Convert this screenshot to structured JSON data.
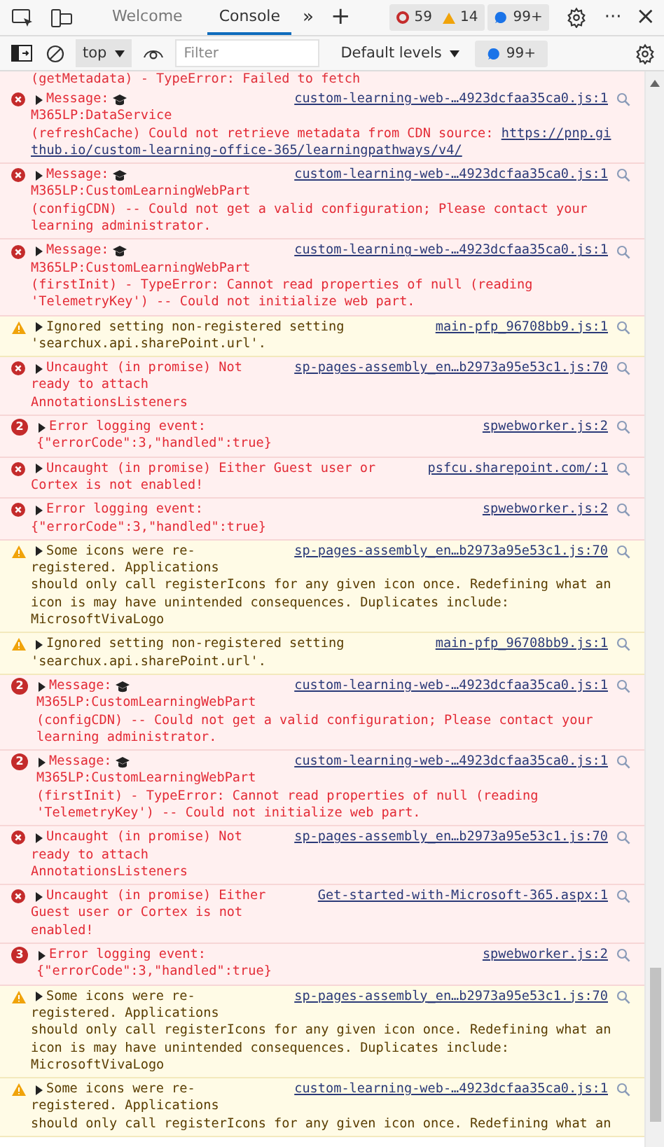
{
  "tabs": [
    {
      "label": "Welcome",
      "selected": false
    },
    {
      "label": "Console",
      "selected": true
    }
  ],
  "more_tabs": "»",
  "add_tab": "+",
  "issue_counts": {
    "errors": "59",
    "warnings": "14"
  },
  "info_count": "99+",
  "more_menu": "···",
  "close": "×",
  "context_select": {
    "value": "top"
  },
  "filter": {
    "placeholder": "Filter"
  },
  "levels_select": {
    "value": "Default levels"
  },
  "filter_info_count": "99+",
  "cut_line": "(getMetadata) - TypeError: Failed to fetch",
  "messages": [
    {
      "kind": "error",
      "expanded": false,
      "head": "Message:",
      "mortarboard": true,
      "source": "custom-learning-web-…4923dcfaa35ca0.js:1",
      "lines": [
        {
          "text": "M365LP:DataService"
        },
        {
          "text": "(refreshCache) Could not retrieve metadata from CDN source: ",
          "url": "https://pnp.gi"
        },
        {
          "url": "thub.io/custom-learning-office-365/learningpathways/v4/"
        }
      ]
    },
    {
      "kind": "error",
      "expanded": false,
      "head": "Message:",
      "mortarboard": true,
      "source": "custom-learning-web-…4923dcfaa35ca0.js:1",
      "lines": [
        {
          "text": "M365LP:CustomLearningWebPart"
        },
        {
          "text": "(configCDN) -- Could not get a valid configuration; Please contact your"
        },
        {
          "text": "learning administrator."
        }
      ]
    },
    {
      "kind": "error",
      "expanded": false,
      "head": "Message:",
      "mortarboard": true,
      "source": "custom-learning-web-…4923dcfaa35ca0.js:1",
      "lines": [
        {
          "text": "M365LP:CustomLearningWebPart"
        },
        {
          "text": "(firstInit) - TypeError: Cannot read properties of null (reading"
        },
        {
          "text": "'TelemetryKey') -- Could not initialize web part."
        }
      ]
    },
    {
      "kind": "warning",
      "expanded": false,
      "head": "Ignored setting non-registered setting",
      "source": "main-pfp_96708bb9.js:1",
      "lines": [
        {
          "text": "'searchux.api.sharePoint.url'."
        }
      ]
    },
    {
      "kind": "error",
      "expanded": false,
      "head": "Uncaught (in promise) Not",
      "source": "sp-pages-assembly_en…b2973a95e53c1.js:70",
      "lines": [
        {
          "text": "ready to attach"
        },
        {
          "text": "AnnotationsListeners"
        }
      ]
    },
    {
      "kind": "error",
      "count": "2",
      "expanded": false,
      "head": "Error logging event:",
      "source": "spwebworker.js:2",
      "lines": [
        {
          "text": "{\"errorCode\":3,\"handled\":true}"
        }
      ]
    },
    {
      "kind": "error",
      "expanded": false,
      "head": "Uncaught (in promise) Either Guest user or",
      "source": "psfcu.sharepoint.com/:1",
      "lines": [
        {
          "text": "Cortex is not enabled!"
        }
      ]
    },
    {
      "kind": "error",
      "expanded": false,
      "head": "Error logging event:",
      "source": "spwebworker.js:2",
      "lines": [
        {
          "text": "{\"errorCode\":3,\"handled\":true}"
        }
      ]
    },
    {
      "kind": "warning",
      "expanded": false,
      "head": "Some icons were re-",
      "source": "sp-pages-assembly_en…b2973a95e53c1.js:70",
      "lines": [
        {
          "text": "registered. Applications"
        },
        {
          "text": "should only call registerIcons for any given icon once. Redefining what an"
        },
        {
          "text": "icon is may have unintended consequences. Duplicates include:"
        },
        {
          "text": "MicrosoftVivaLogo"
        }
      ]
    },
    {
      "kind": "warning",
      "expanded": false,
      "head": "Ignored setting non-registered setting",
      "source": "main-pfp_96708bb9.js:1",
      "lines": [
        {
          "text": "'searchux.api.sharePoint.url'."
        }
      ]
    },
    {
      "kind": "error",
      "count": "2",
      "expanded": false,
      "head": "Message:",
      "mortarboard": true,
      "source": "custom-learning-web-…4923dcfaa35ca0.js:1",
      "lines": [
        {
          "text": "M365LP:CustomLearningWebPart"
        },
        {
          "text": "(configCDN) -- Could not get a valid configuration; Please contact your"
        },
        {
          "text": "learning administrator."
        }
      ]
    },
    {
      "kind": "error",
      "count": "2",
      "expanded": false,
      "head": "Message:",
      "mortarboard": true,
      "source": "custom-learning-web-…4923dcfaa35ca0.js:1",
      "lines": [
        {
          "text": "M365LP:CustomLearningWebPart"
        },
        {
          "text": "(firstInit) - TypeError: Cannot read properties of null (reading"
        },
        {
          "text": "'TelemetryKey') -- Could not initialize web part."
        }
      ]
    },
    {
      "kind": "error",
      "expanded": false,
      "head": "Uncaught (in promise) Not",
      "source": "sp-pages-assembly_en…b2973a95e53c1.js:70",
      "lines": [
        {
          "text": "ready to attach"
        },
        {
          "text": "AnnotationsListeners"
        }
      ]
    },
    {
      "kind": "error",
      "expanded": false,
      "head": "Uncaught (in promise) Either",
      "source": "Get-started-with-Microsoft-365.aspx:1",
      "lines": [
        {
          "text": "Guest user or Cortex is not"
        },
        {
          "text": "enabled!"
        }
      ]
    },
    {
      "kind": "error",
      "count": "3",
      "expanded": false,
      "head": "Error logging event:",
      "source": "spwebworker.js:2",
      "lines": [
        {
          "text": "{\"errorCode\":3,\"handled\":true}"
        }
      ]
    },
    {
      "kind": "warning",
      "expanded": false,
      "head": "Some icons were re-",
      "source": "sp-pages-assembly_en…b2973a95e53c1.js:70",
      "lines": [
        {
          "text": "registered. Applications"
        },
        {
          "text": "should only call registerIcons for any given icon once. Redefining what an"
        },
        {
          "text": "icon is may have unintended consequences. Duplicates include:"
        },
        {
          "text": "MicrosoftVivaLogo"
        }
      ]
    },
    {
      "kind": "warning",
      "expanded": false,
      "head": "Some icons were re-",
      "source": "custom-learning-web-…4923dcfaa35ca0.js:1",
      "lines": [
        {
          "text": "registered. Applications"
        },
        {
          "text": "should only call registerIcons for any given icon once. Redefining what an"
        }
      ]
    }
  ]
}
